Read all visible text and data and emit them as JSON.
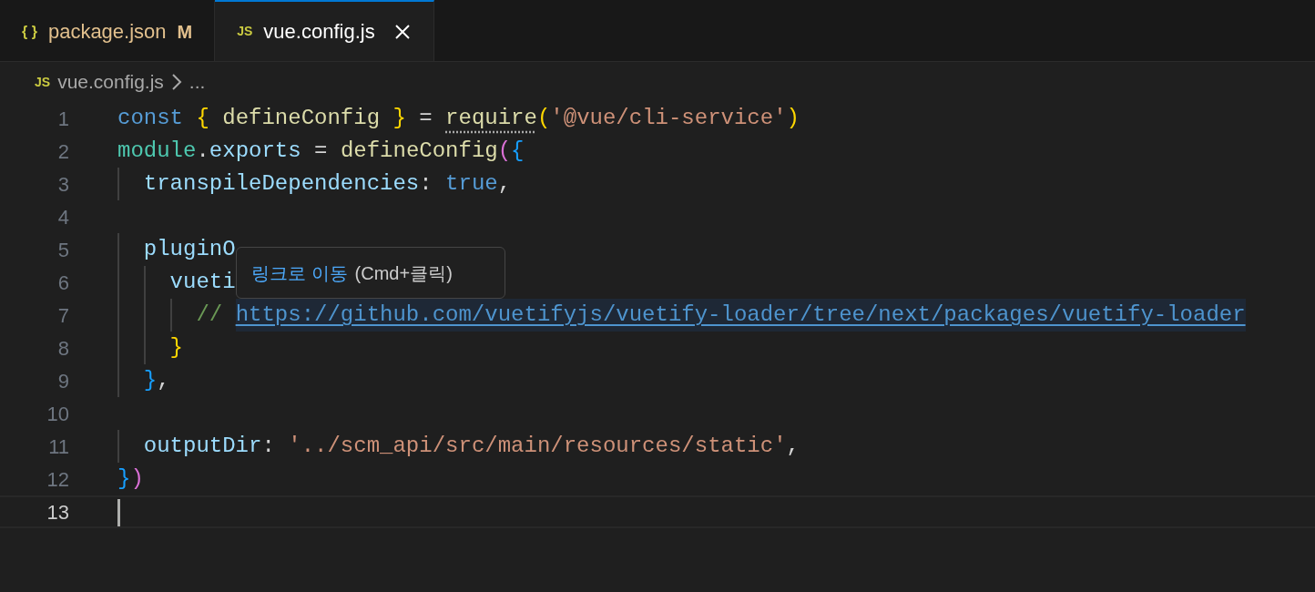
{
  "tabs": [
    {
      "icon": "{ }",
      "label": "package.json",
      "badge": "M",
      "selected": false,
      "modified": true
    },
    {
      "icon": "JS",
      "label": "vue.config.js",
      "selected": true,
      "modified": false
    }
  ],
  "breadcrumb": {
    "icon": "JS",
    "file": "vue.config.js",
    "rest": "..."
  },
  "lines": [
    {
      "number": "1",
      "tokens": [
        {
          "text": "const ",
          "kind": "keyword"
        },
        {
          "text": "{",
          "kind": "brace1"
        },
        {
          "text": " defineConfig ",
          "kind": "function"
        },
        {
          "text": "}",
          "kind": "brace1"
        },
        {
          "text": " = ",
          "kind": "plain"
        },
        {
          "text": "require",
          "kind": "function",
          "hint": true
        },
        {
          "text": "(",
          "kind": "brace1"
        },
        {
          "text": "'@vue/cli-service'",
          "kind": "string"
        },
        {
          "text": ")",
          "kind": "brace1"
        }
      ]
    },
    {
      "number": "2",
      "tokens": [
        {
          "text": "module",
          "kind": "type"
        },
        {
          "text": ".",
          "kind": "plain"
        },
        {
          "text": "exports",
          "kind": "variable"
        },
        {
          "text": " = ",
          "kind": "plain"
        },
        {
          "text": "defineConfig",
          "kind": "function"
        },
        {
          "text": "(",
          "kind": "brace2"
        },
        {
          "text": "{",
          "kind": "brace3"
        }
      ]
    },
    {
      "number": "3",
      "tokens": [
        {
          "text": "  transpileDependencies",
          "kind": "variable"
        },
        {
          "text": ": ",
          "kind": "plain"
        },
        {
          "text": "true",
          "kind": "keyword"
        },
        {
          "text": ",",
          "kind": "plain"
        }
      ]
    },
    {
      "number": "4"
    },
    {
      "number": "5",
      "tokens": [
        {
          "text": "  pluginO",
          "kind": "variable"
        }
      ]
    },
    {
      "number": "6",
      "tokens": [
        {
          "text": "    vueti",
          "kind": "variable"
        }
      ]
    },
    {
      "number": "7",
      "tokens": [
        {
          "text": "      // ",
          "kind": "comment"
        },
        {
          "text": "https://github.com/vuetifyjs/vuetify-loader/tree/next/packages/vuetify-loader",
          "kind": "link",
          "hovered": true
        }
      ]
    },
    {
      "number": "8",
      "tokens": [
        {
          "text": "    }",
          "kind": "brace1"
        }
      ]
    },
    {
      "number": "9",
      "tokens": [
        {
          "text": "  }",
          "kind": "brace3"
        },
        {
          "text": ",",
          "kind": "plain"
        }
      ]
    },
    {
      "number": "10"
    },
    {
      "number": "11",
      "tokens": [
        {
          "text": "  outputDir",
          "kind": "variable"
        },
        {
          "text": ": ",
          "kind": "plain"
        },
        {
          "text": "'../scm_api/src/main/resources/static'",
          "kind": "string"
        },
        {
          "text": ",",
          "kind": "plain"
        }
      ]
    },
    {
      "number": "12",
      "tokens": [
        {
          "text": "}",
          "kind": "brace3"
        },
        {
          "text": ")",
          "kind": "brace2"
        }
      ]
    },
    {
      "number": "13",
      "current": true
    }
  ],
  "tooltip": {
    "link_text": "링크로 이동",
    "shortcut": "(Cmd+클릭)"
  }
}
